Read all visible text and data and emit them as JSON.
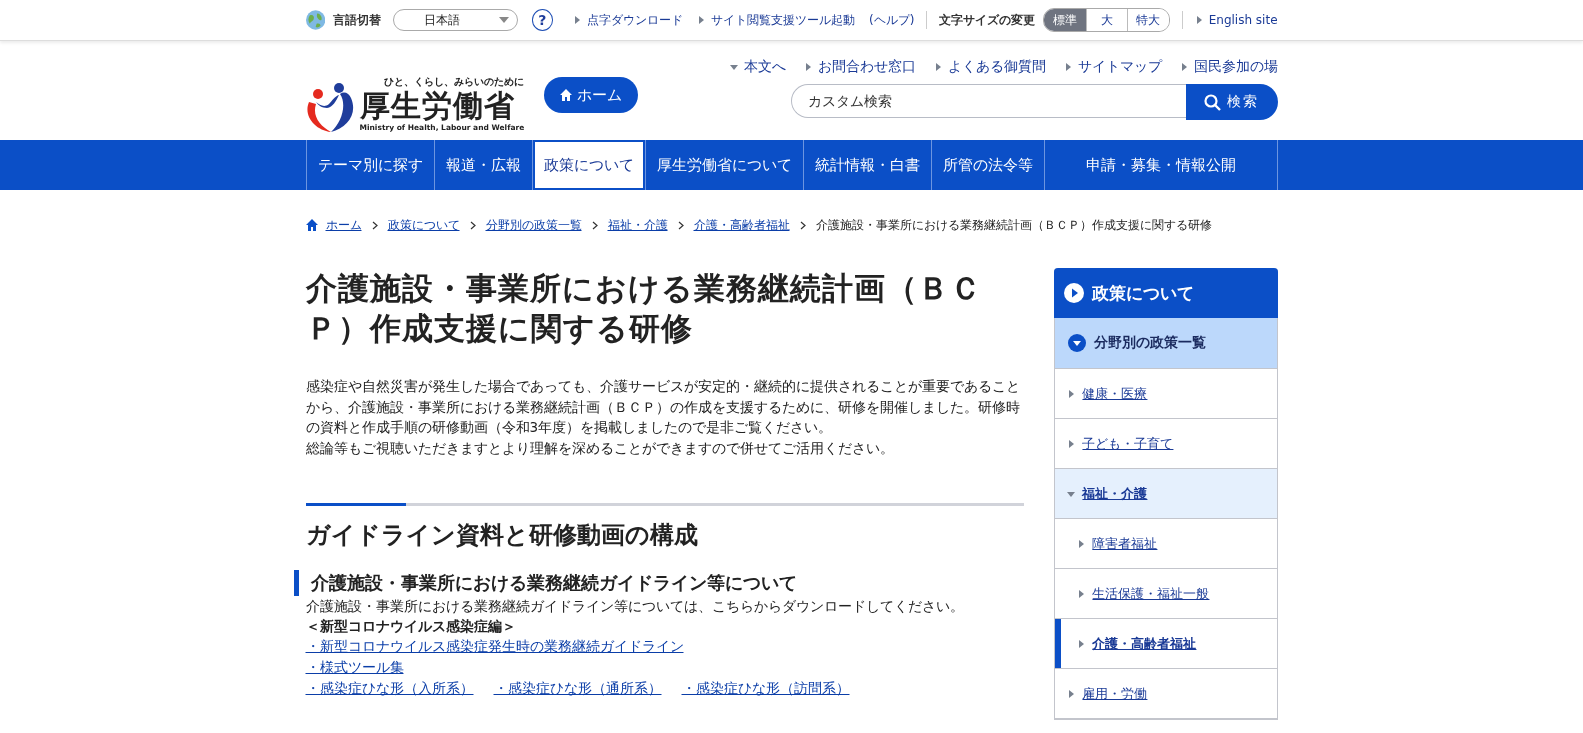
{
  "top_bar": {
    "language_label": "言語切替",
    "language_select": "日本語",
    "help": "?",
    "links": [
      {
        "text": "点字ダウンロード",
        "kind": "arrow"
      },
      {
        "text": "サイト閲覧支援ツール起動",
        "kind": "arrow"
      },
      {
        "text": "(ヘルプ)",
        "kind": "plain"
      }
    ],
    "font_size": {
      "label": "文字サイズの変更",
      "options": [
        {
          "label": "標準",
          "selected": true
        },
        {
          "label": "大",
          "selected": false
        },
        {
          "label": "特大",
          "selected": false
        }
      ]
    },
    "english_link": "English site"
  },
  "header": {
    "tagline": "ひと、くらし、みらいのために",
    "logo_name": "厚生労働省",
    "logo_english": "Ministry of Health, Labour and Welfare",
    "home_button": "ホーム",
    "utility_links": [
      {
        "text": "本文へ",
        "kind": "down"
      },
      {
        "text": "お問合わせ窓口",
        "kind": "right"
      },
      {
        "text": "よくある御質問",
        "kind": "right"
      },
      {
        "text": "サイトマップ",
        "kind": "right"
      },
      {
        "text": "国民参加の場",
        "kind": "right"
      }
    ],
    "search": {
      "placeholder": "カスタム検索",
      "button": "検索"
    }
  },
  "nav": [
    {
      "label": "テーマ別に探す",
      "selected": false
    },
    {
      "label": "報道・広報",
      "selected": false
    },
    {
      "label": "政策について",
      "selected": true
    },
    {
      "label": "厚生労働省について",
      "selected": false
    },
    {
      "label": "統計情報・白書",
      "selected": false
    },
    {
      "label": "所管の法令等",
      "selected": false
    },
    {
      "label": "申請・募集・情報公開",
      "selected": false
    }
  ],
  "breadcrumb": {
    "links": [
      "ホーム",
      "政策について",
      "分野別の政策一覧",
      "福祉・介護",
      "介護・高齢者福祉"
    ],
    "current": "介護施設・事業所における業務継続計画（ＢＣＰ）作成支援に関する研修"
  },
  "main": {
    "title": "介護施設・事業所における業務継続計画（ＢＣＰ）作成支援に関する研修",
    "intro": [
      "感染症や自然災害が発生した場合であっても、介護サービスが安定的・継続的に提供されることが重要であることから、介護施設・事業所における業務継続計画（ＢＣＰ）の作成を支援するために、研修を開催しました。研修時の資料と作成手順の研修動画（令和3年度）を掲載しましたので是非ご覧ください。",
      "総論等もご視聴いただきますとより理解を深めることができますので併せてご活用ください。"
    ],
    "section_heading": "ガイドライン資料と研修動画の構成",
    "subsection_heading": "介護施設・事業所における業務継続ガイドライン等について",
    "subsection_text": "介護施設・事業所における業務継続ガイドライン等については、こちらからダウンロードしてください。",
    "group_label": "＜新型コロナウイルス感染症編＞",
    "link_rows": [
      [
        "・新型コロナウイルス感染症発生時の業務継続ガイドライン"
      ],
      [
        "・様式ツール集"
      ],
      [
        "・感染症ひな形（入所系）",
        "・感染症ひな形（通所系）",
        "・感染症ひな形（訪問系）"
      ]
    ]
  },
  "sidebar": {
    "title": "政策について",
    "items": [
      {
        "label": "分野別の政策一覧",
        "expanded": true,
        "selected": false,
        "children": [
          {
            "label": "健康・医療",
            "expanded": false,
            "selected": false
          },
          {
            "label": "子ども・子育て",
            "expanded": false,
            "selected": false
          },
          {
            "label": "福祉・介護",
            "expanded": true,
            "selected": false,
            "children": [
              {
                "label": "障害者福祉",
                "expanded": false,
                "selected": false
              },
              {
                "label": "生活保護・福祉一般",
                "expanded": false,
                "selected": false
              },
              {
                "label": "介護・高齢者福祉",
                "expanded": false,
                "selected": true
              }
            ]
          },
          {
            "label": "雇用・労働",
            "expanded": false,
            "selected": false
          }
        ]
      }
    ]
  }
}
